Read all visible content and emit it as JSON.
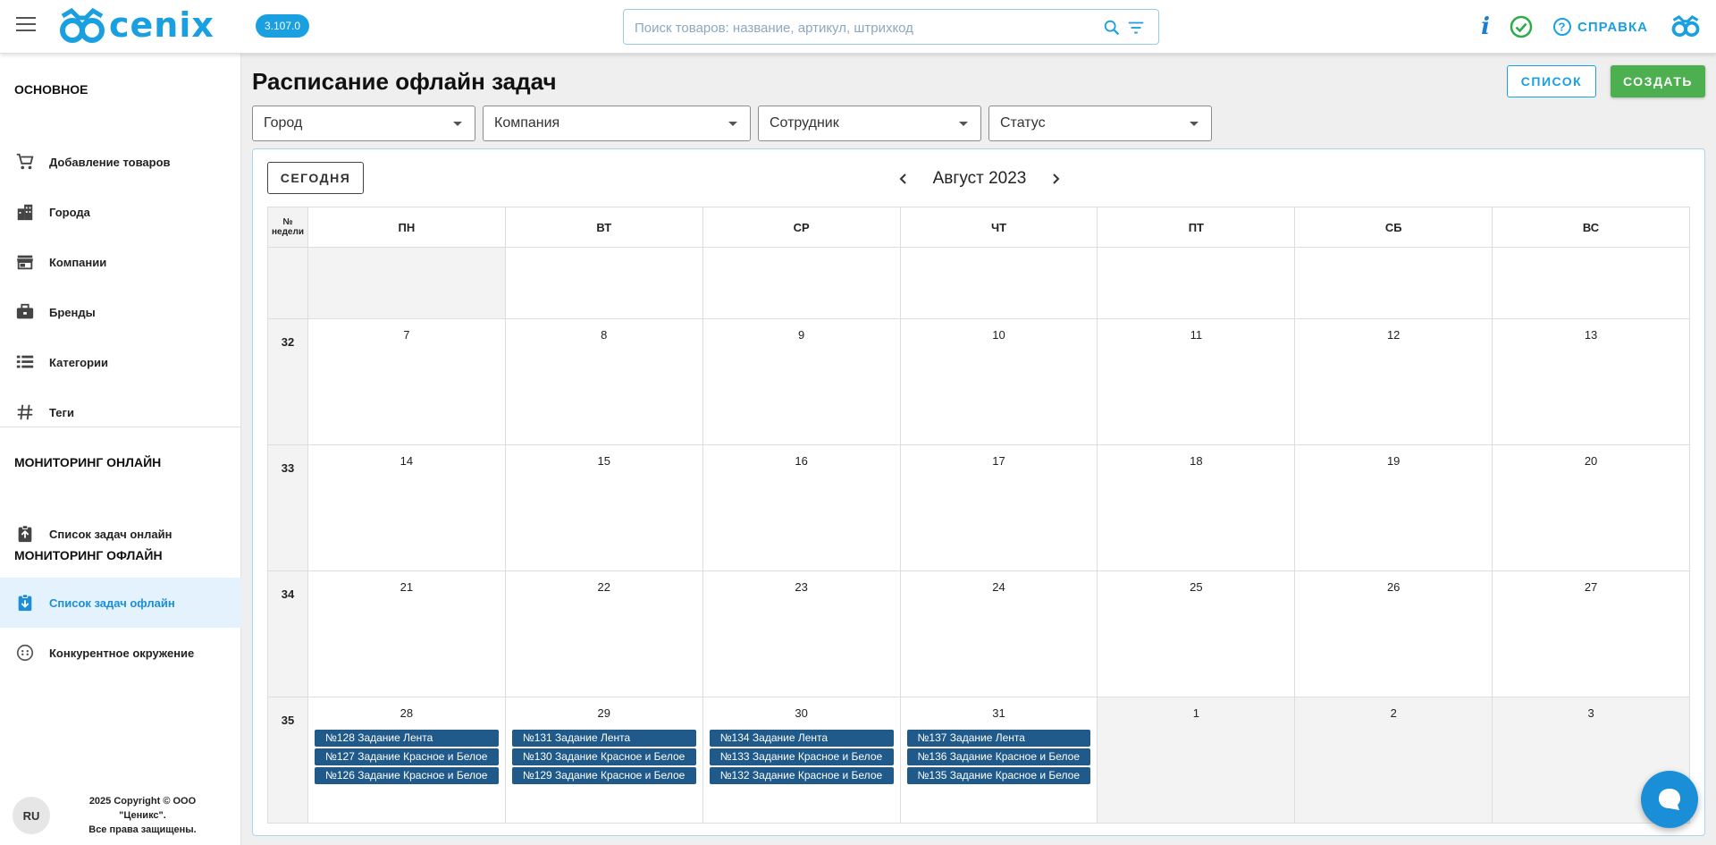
{
  "header": {
    "logo_text": "cenix",
    "version": "3.107.0",
    "search_placeholder": "Поиск товаров: название, артикул, штрихкод",
    "help_label": "СПРАВКА"
  },
  "sidebar": {
    "section_main": "ОСНОВНОЕ",
    "main_items": [
      {
        "label": "Добавление товаров",
        "icon": "cart-icon"
      },
      {
        "label": "Города",
        "icon": "city-icon"
      },
      {
        "label": "Компании",
        "icon": "store-icon"
      },
      {
        "label": "Бренды",
        "icon": "briefcase-icon"
      },
      {
        "label": "Категории",
        "icon": "list-icon"
      },
      {
        "label": "Теги",
        "icon": "hashtag-icon"
      }
    ],
    "section_online": "МОНИТОРИНГ ОНЛАЙН",
    "online_items": [
      {
        "label": "Список задач онлайн",
        "icon": "clipboard-icon"
      }
    ],
    "section_offline": "МОНИТОРИНГ ОФЛАЙН",
    "offline_items": [
      {
        "label": "Список задач офлайн",
        "icon": "clipboard-download-icon",
        "active": true
      },
      {
        "label": "Конкурентное окружение",
        "icon": "radar-icon"
      }
    ],
    "language": "RU",
    "copyright_line1": "2025 Copyright © ООО \"Ценикс\".",
    "copyright_line2": "Все права защищены."
  },
  "page": {
    "title": "Расписание офлайн задач",
    "list_button": "СПИСОК",
    "create_button": "СОЗДАТЬ"
  },
  "filters": [
    "Город",
    "Компания",
    "Сотрудник",
    "Статус"
  ],
  "calendar": {
    "today_button": "СЕГОДНЯ",
    "month_label": "Август 2023",
    "week_header_line1": "№",
    "week_header_line2": "недели",
    "weekdays": [
      "ПН",
      "ВТ",
      "СР",
      "ЧТ",
      "ПТ",
      "СБ",
      "ВС"
    ],
    "weeks": [
      {
        "num": "",
        "days": [
          {
            "d": "",
            "grey": true,
            "events": []
          },
          {
            "d": "",
            "events": []
          },
          {
            "d": "",
            "events": []
          },
          {
            "d": "",
            "events": []
          },
          {
            "d": "",
            "events": []
          },
          {
            "d": "",
            "events": []
          },
          {
            "d": "",
            "events": []
          }
        ]
      },
      {
        "num": "32",
        "days": [
          {
            "d": "7",
            "events": []
          },
          {
            "d": "8",
            "events": []
          },
          {
            "d": "9",
            "events": []
          },
          {
            "d": "10",
            "events": []
          },
          {
            "d": "11",
            "events": []
          },
          {
            "d": "12",
            "events": []
          },
          {
            "d": "13",
            "events": []
          }
        ]
      },
      {
        "num": "33",
        "days": [
          {
            "d": "14",
            "events": []
          },
          {
            "d": "15",
            "events": []
          },
          {
            "d": "16",
            "events": []
          },
          {
            "d": "17",
            "events": []
          },
          {
            "d": "18",
            "events": []
          },
          {
            "d": "19",
            "events": []
          },
          {
            "d": "20",
            "events": []
          }
        ]
      },
      {
        "num": "34",
        "days": [
          {
            "d": "21",
            "events": []
          },
          {
            "d": "22",
            "events": []
          },
          {
            "d": "23",
            "events": []
          },
          {
            "d": "24",
            "events": []
          },
          {
            "d": "25",
            "events": []
          },
          {
            "d": "26",
            "events": []
          },
          {
            "d": "27",
            "events": []
          }
        ]
      },
      {
        "num": "35",
        "days": [
          {
            "d": "28",
            "events": [
              "№128 Задание Лента",
              "№127 Задание Красное и Белое",
              "№126 Задание Красное и Белое"
            ]
          },
          {
            "d": "29",
            "events": [
              "№131 Задание Лента",
              "№130 Задание Красное и Белое",
              "№129 Задание Красное и Белое"
            ]
          },
          {
            "d": "30",
            "events": [
              "№134 Задание Лента",
              "№133 Задание Красное и Белое",
              "№132 Задание Красное и Белое"
            ]
          },
          {
            "d": "31",
            "events": [
              "№137 Задание Лента",
              "№136 Задание Красное и Белое",
              "№135 Задание Красное и Белое"
            ]
          },
          {
            "d": "1",
            "grey": true,
            "events": []
          },
          {
            "d": "2",
            "grey": true,
            "events": []
          },
          {
            "d": "3",
            "grey": true,
            "events": []
          }
        ]
      }
    ]
  },
  "colors": {
    "accent": "#1aa0e0",
    "create": "#4caf50",
    "event": "#1f5a8a",
    "success": "#2eaa4a"
  }
}
